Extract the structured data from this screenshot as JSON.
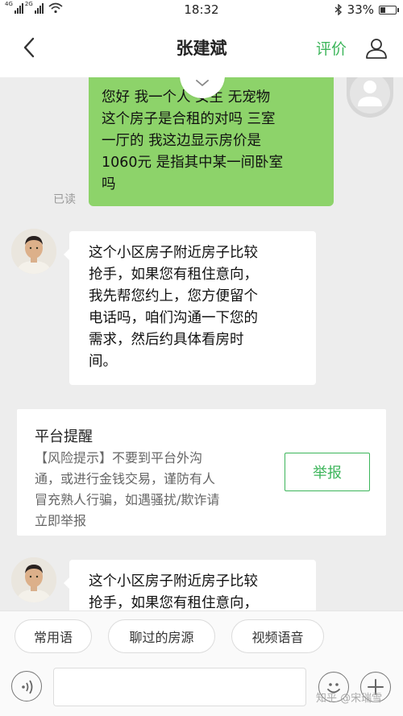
{
  "status_bar": {
    "network_1": "4G",
    "network_2": "2G",
    "time": "18:32",
    "battery": "33%",
    "battery_level": 0.33
  },
  "header": {
    "title": "张建斌",
    "rate_label": "评价",
    "icons": {
      "back": "chevron-left-icon",
      "profile": "person-icon"
    }
  },
  "messages": [
    {
      "side": "me",
      "lines": [
        "您好 我一个人 女生 无宠物",
        "这个房子是合租的对吗 三室",
        "一厅的 我这边显示房价是",
        "1060元 是指其中某一间卧室",
        "吗"
      ],
      "status": "已读"
    },
    {
      "side": "agent",
      "lines": [
        "这个小区房子附近房子比较",
        "抢手，如果您有租住意向，",
        "我先帮您约上，您方便留个",
        "电话吗，咱们沟通一下您的",
        "需求，然后约具体看房时",
        "间。"
      ]
    },
    {
      "side": "agent",
      "lines": [
        "这个小区房子附近房子比较",
        "抢手，如果您有租住意向，"
      ]
    }
  ],
  "notice": {
    "title": "平台提醒",
    "lines": [
      "【风险提示】不要到平台外沟",
      "通，或进行金钱交易，谨防有人",
      "冒充熟人行骗，如遇骚扰/欺诈请",
      "立即举报"
    ],
    "report_label": "举报"
  },
  "quick_replies": [
    "常用语",
    "聊过的房源",
    "视频语音"
  ],
  "input": {
    "placeholder": ""
  },
  "watermark": "知乎 @宋瑞雪",
  "colors": {
    "accent": "#3cb55a",
    "my_bubble": "#8dd36a",
    "background": "#ededed"
  }
}
